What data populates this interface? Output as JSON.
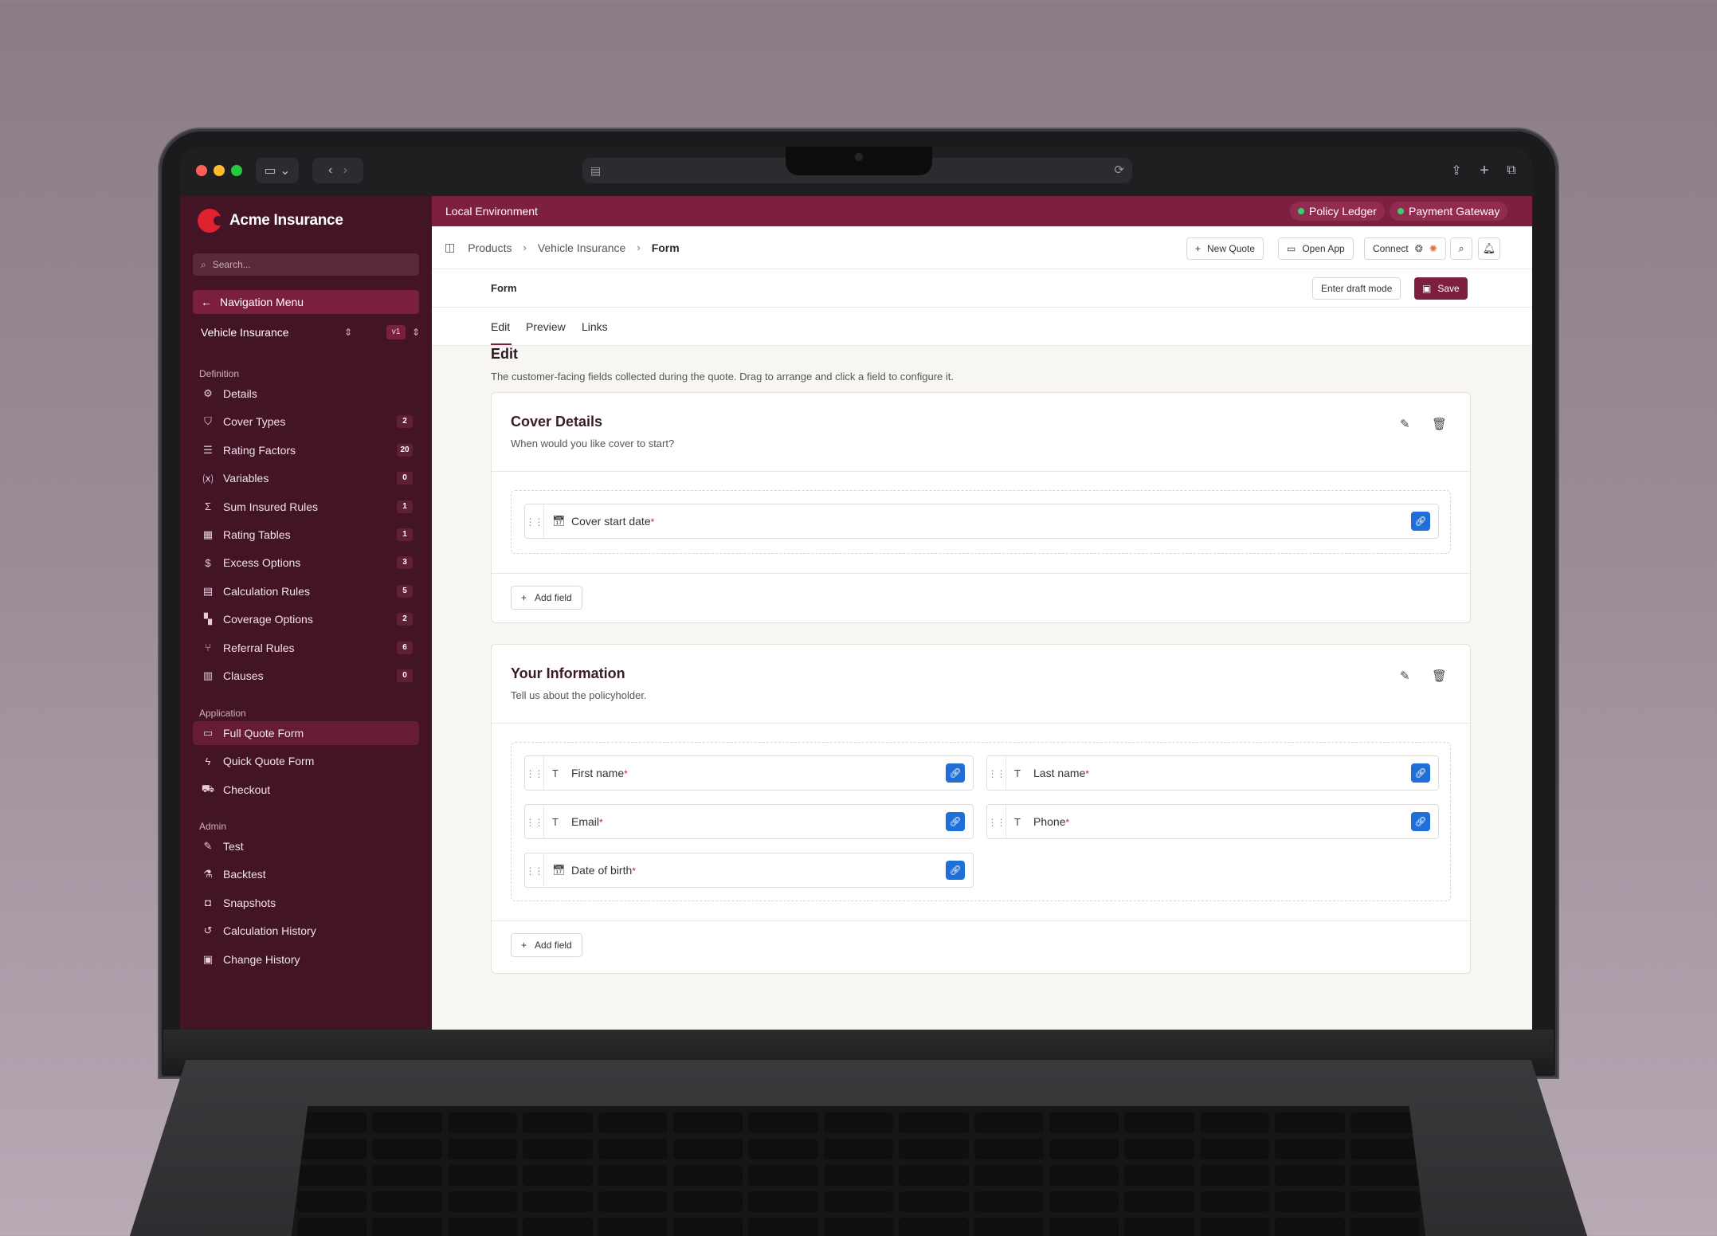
{
  "browser": {
    "icons": [
      "sidebar-toggle-icon",
      "chevron-down-icon",
      "back-icon",
      "forward-icon",
      "page-icon",
      "translate-icon",
      "reload-icon",
      "share-icon",
      "new-tab-icon",
      "tabs-overview-icon"
    ]
  },
  "sidebar": {
    "brand": "Acme Insurance",
    "search_placeholder": "Search...",
    "nav_menu_label": "Navigation Menu",
    "product": "Vehicle Insurance",
    "version": "v1",
    "sections": {
      "definition": "Definition",
      "application": "Application",
      "admin": "Admin"
    },
    "definition_items": [
      {
        "label": "Details",
        "icon": "gear-icon",
        "count": ""
      },
      {
        "label": "Cover Types",
        "icon": "shield-icon",
        "count": "2"
      },
      {
        "label": "Rating Factors",
        "icon": "sliders-icon",
        "count": "20"
      },
      {
        "label": "Variables",
        "icon": "variable-icon",
        "count": "0"
      },
      {
        "label": "Sum Insured Rules",
        "icon": "sigma-icon",
        "count": "1"
      },
      {
        "label": "Rating Tables",
        "icon": "table-icon",
        "count": "1"
      },
      {
        "label": "Excess Options",
        "icon": "dollar-doc-icon",
        "count": "3"
      },
      {
        "label": "Calculation Rules",
        "icon": "calculator-icon",
        "count": "5"
      },
      {
        "label": "Coverage Options",
        "icon": "blocks-icon",
        "count": "2"
      },
      {
        "label": "Referral Rules",
        "icon": "split-icon",
        "count": "6"
      },
      {
        "label": "Clauses",
        "icon": "scroll-icon",
        "count": "0"
      }
    ],
    "application_items": [
      {
        "label": "Full Quote Form",
        "icon": "form-icon",
        "active": true
      },
      {
        "label": "Quick Quote Form",
        "icon": "zap-icon",
        "active": false
      },
      {
        "label": "Checkout",
        "icon": "cart-icon",
        "active": false
      }
    ],
    "admin_items": [
      {
        "label": "Test",
        "icon": "pencil-icon"
      },
      {
        "label": "Backtest",
        "icon": "flask-icon"
      },
      {
        "label": "Snapshots",
        "icon": "camera-icon"
      },
      {
        "label": "Calculation History",
        "icon": "history-icon"
      },
      {
        "label": "Change History",
        "icon": "clipboard-icon"
      }
    ]
  },
  "env_bar": {
    "label": "Local Environment",
    "pills": [
      "Policy Ledger",
      "Payment Gateway"
    ],
    "status_color": "#36d06c"
  },
  "breadcrumb": {
    "items": [
      "Products",
      "Vehicle Insurance",
      "Form"
    ]
  },
  "toolbar": {
    "new_quote": "New Quote",
    "open_app": "Open App",
    "connect": "Connect"
  },
  "form_header": {
    "title": "Form",
    "draft_label": "Enter draft mode",
    "save_label": "Save"
  },
  "tabs": [
    "Edit",
    "Preview",
    "Links"
  ],
  "edit": {
    "title": "Edit",
    "description": "The customer-facing fields collected during the quote. Drag to arrange and click a field to configure it."
  },
  "sections": [
    {
      "title": "Cover Details",
      "subtitle": "When would you like cover to start?",
      "fields": [
        {
          "label": "Cover start date",
          "type": "date"
        }
      ],
      "add_label": "Add field"
    },
    {
      "title": "Your Information",
      "subtitle": "Tell us about the policyholder.",
      "fields": [
        {
          "label": "First name",
          "type": "text"
        },
        {
          "label": "Last name",
          "type": "text"
        },
        {
          "label": "Email",
          "type": "text"
        },
        {
          "label": "Phone",
          "type": "text"
        },
        {
          "label": "Date of birth",
          "type": "date"
        }
      ],
      "add_label": "Add field"
    }
  ],
  "required_marker": "*",
  "colors": {
    "brand": "#7d1f41",
    "sidebar_bg": "#431326",
    "link_button": "#1e6fd8",
    "logo": "#e02230"
  }
}
